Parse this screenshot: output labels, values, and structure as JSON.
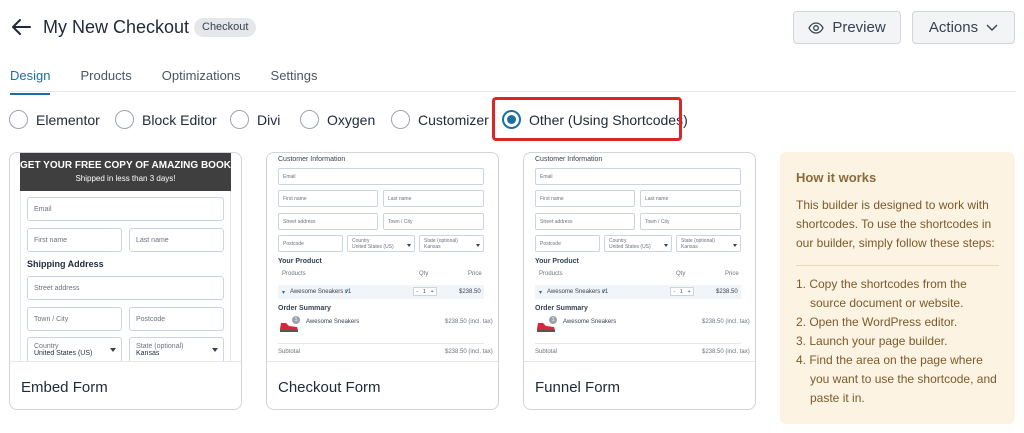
{
  "header": {
    "title": "My New Checkout",
    "badge": "Checkout",
    "preview_label": "Preview",
    "actions_label": "Actions"
  },
  "tabs": [
    "Design",
    "Products",
    "Optimizations",
    "Settings"
  ],
  "active_tab": "Design",
  "builders": [
    "Elementor",
    "Block Editor",
    "Divi",
    "Oxygen",
    "Customizer",
    "Other (Using Shortcodes)"
  ],
  "selected_builder": "Other (Using Shortcodes)",
  "colors": {
    "accent": "#1d6fa3",
    "highlight": "#dc2626",
    "info_bg": "#fdf3e3"
  },
  "cards": {
    "embed": {
      "label": "Embed Form",
      "banner_title": "GET YOUR FREE COPY OF AMAZING BOOK",
      "banner_subtitle": "Shipped in less than 3 days!",
      "email": "Email",
      "first_name": "First name",
      "last_name": "Last name",
      "shipping_heading": "Shipping Address",
      "street": "Street address",
      "town": "Town / City",
      "postcode": "Postcode",
      "country_label": "Country",
      "country_value": "United States (US)",
      "state_label": "State (optional)",
      "state_value": "Kansas"
    },
    "checkout": {
      "label": "Checkout Form",
      "customer_heading": "Customer Information",
      "email": "Email",
      "first_name": "First name",
      "last_name": "Last name",
      "street": "Street address",
      "town": "Town / City",
      "postcode": "Postcode",
      "country_label": "Country",
      "country_value": "United States (US)",
      "state_label": "State (optional)",
      "state_value": "Kansas",
      "product_heading": "Your Product",
      "col_products": "Products",
      "col_qty": "Qty",
      "col_price": "Price",
      "product_name": "Awesome Sneakers v1",
      "qty": "1",
      "price": "$238.50",
      "summary_heading": "Order Summary",
      "summary_item": "Awesome Sneakers",
      "summary_price": "$238.50 (incl. tax)",
      "subtotal_label": "Subtotal",
      "subtotal_value": "$238.50 (incl. tax)"
    },
    "funnel": {
      "label": "Funnel Form",
      "customer_heading": "Customer Information",
      "email": "Email",
      "first_name": "First name",
      "last_name": "Last name",
      "street": "Street address",
      "town": "Town / City",
      "postcode": "Postcode",
      "country_label": "Country",
      "country_value": "United States (US)",
      "state_label": "State (optional)",
      "state_value": "Kansas",
      "product_heading": "Your Product",
      "col_products": "Products",
      "col_qty": "Qty",
      "col_price": "Price",
      "product_name": "Awesome Sneakers v1",
      "qty": "1",
      "price": "$238.50",
      "summary_heading": "Order Summary",
      "summary_item": "Awesome Sneakers",
      "summary_price": "$238.50 (incl. tax)",
      "subtotal_label": "Subtotal",
      "subtotal_value": "$238.50 (incl. tax)"
    }
  },
  "how_it_works": {
    "title": "How it works",
    "intro": "This builder is designed to work with shortcodes. To use the shortcodes in our builder, simply follow these steps:",
    "steps": [
      "1. Copy the shortcodes from the source document or website.",
      "2. Open the WordPress editor.",
      "3. Launch your page builder.",
      "4. Find the area on the page where you want to use the shortcode, and paste it in."
    ]
  }
}
